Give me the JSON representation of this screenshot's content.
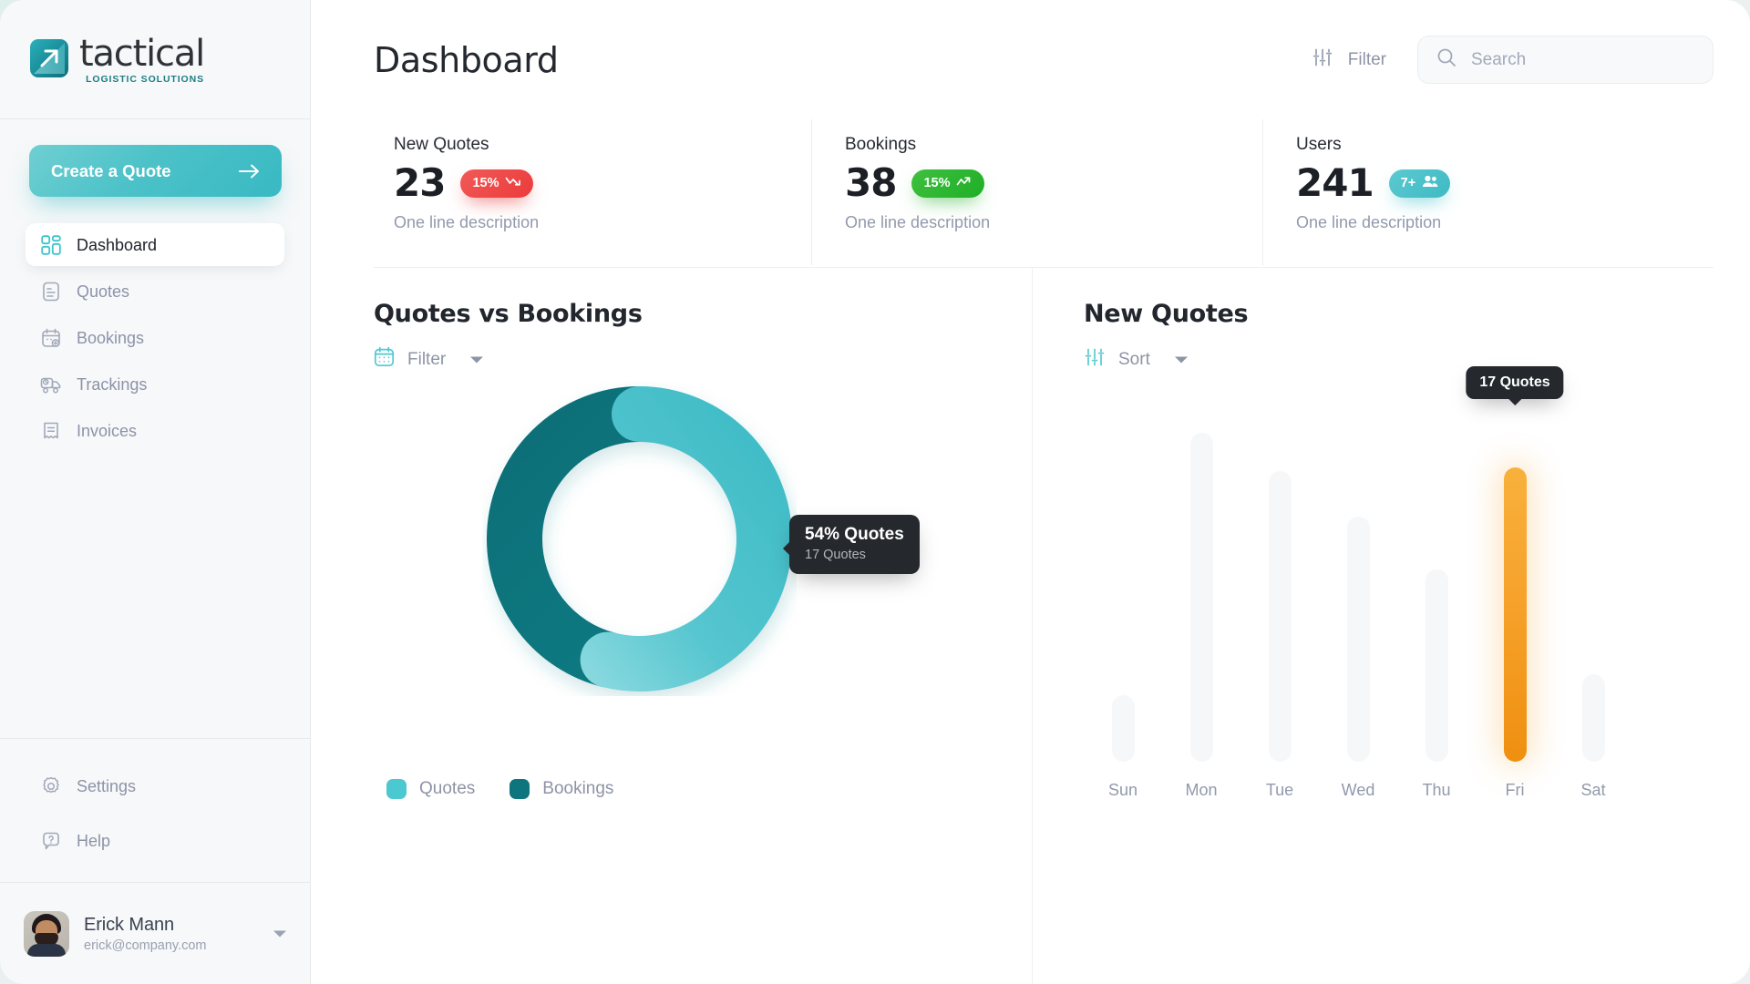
{
  "brand": {
    "word": "tactical",
    "tagline": "LOGISTIC SOLUTIONS",
    "logo_icon": "tactical-logo-icon",
    "accent_teal": "#3ab6c0",
    "accent_dark_teal": "#0d7279"
  },
  "sidebar": {
    "cta": {
      "label": "Create a Quote",
      "icon": "arrow-right-icon"
    },
    "items": [
      {
        "label": "Dashboard",
        "icon": "grid-icon",
        "active": true
      },
      {
        "label": "Quotes",
        "icon": "document-lines-icon",
        "active": false
      },
      {
        "label": "Bookings",
        "icon": "calendar-plus-icon",
        "active": false
      },
      {
        "label": "Trackings",
        "icon": "delivery-truck-icon",
        "active": false
      },
      {
        "label": "Invoices",
        "icon": "invoice-icon",
        "active": false
      }
    ],
    "bottom_items": [
      {
        "label": "Settings",
        "icon": "gear-icon"
      },
      {
        "label": "Help",
        "icon": "question-bubble-icon"
      }
    ],
    "user": {
      "name": "Erick Mann",
      "email": "erick@company.com",
      "avatar_icon": "user-avatar",
      "caret_icon": "chevron-down-icon"
    }
  },
  "header": {
    "title": "Dashboard",
    "filter_label": "Filter",
    "filter_icon": "sliders-icon",
    "search": {
      "placeholder": "Search",
      "value": "",
      "icon": "search-icon"
    }
  },
  "stats": [
    {
      "title": "New Quotes",
      "value": "23",
      "badge": {
        "text": "15%",
        "icon": "trend-down-icon",
        "type": "down",
        "color": "#ec3b3b"
      },
      "description": "One line description"
    },
    {
      "title": "Bookings",
      "value": "38",
      "badge": {
        "text": "15%",
        "icon": "trend-up-icon",
        "type": "up",
        "color": "#1fae27"
      },
      "description": "One line description"
    },
    {
      "title": "Users",
      "value": "241",
      "badge": {
        "text": "7+",
        "icon": "users-icon",
        "type": "teal",
        "color": "#3ebac4"
      },
      "description": "One line description"
    }
  ],
  "panels": {
    "donut": {
      "title": "Quotes vs Bookings",
      "control_label": "Filter",
      "control_icon": "calendar-icon",
      "caret_icon": "chevron-down-icon",
      "tooltip": {
        "main": "54% Quotes",
        "sub": "17 Quotes"
      }
    },
    "bars": {
      "title": "New Quotes",
      "control_label": "Sort",
      "control_icon": "sliders-icon",
      "caret_icon": "chevron-down-icon",
      "tooltip": "17 Quotes"
    }
  },
  "chart_data": [
    {
      "type": "pie",
      "title": "Quotes vs Bookings",
      "subtype": "donut",
      "categories": [
        "Quotes",
        "Bookings"
      ],
      "values": [
        54,
        46
      ],
      "counts": [
        17,
        14
      ],
      "unit": "%",
      "colors": [
        "#4cbfcb",
        "#0d7279"
      ],
      "legend": [
        "Quotes",
        "Bookings"
      ],
      "legend_position": "bottom-left",
      "annotations": [
        "54% Quotes",
        "17 Quotes"
      ],
      "start_angle": 0,
      "hole_ratio": 0.62
    },
    {
      "type": "bar",
      "title": "New Quotes",
      "categories": [
        "Sun",
        "Mon",
        "Tue",
        "Wed",
        "Thu",
        "Fri",
        "Sat"
      ],
      "values": [
        4,
        19,
        17,
        14,
        11,
        17,
        5
      ],
      "highlight_index": 5,
      "highlight_label": "17 Quotes",
      "xlabel": "",
      "ylabel": "",
      "ylim": [
        0,
        20
      ],
      "grid": false,
      "legend_position": "none",
      "bar_color_active": "#f6a22b",
      "bar_color_inactive": "#f5f7f9"
    }
  ]
}
